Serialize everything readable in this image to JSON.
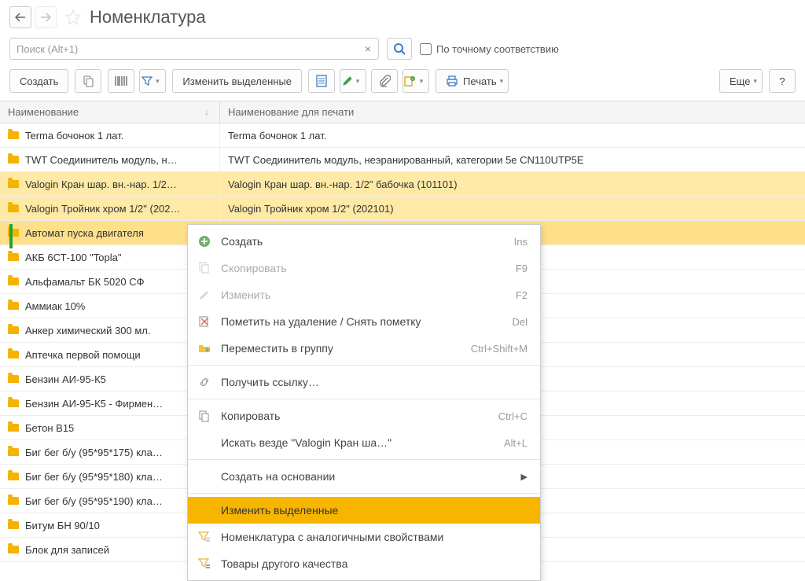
{
  "header": {
    "title": "Номенклатура"
  },
  "search": {
    "placeholder": "Поиск (Alt+1)",
    "exact_label": "По точному соответствию"
  },
  "toolbar": {
    "create": "Создать",
    "change_selected": "Изменить выделенные",
    "print": "Печать",
    "more": "Еще",
    "help": "?"
  },
  "columns": {
    "name": "Наименование",
    "print_name": "Наименование для печати"
  },
  "rows": [
    {
      "name": "Terma бочонок 1 лат.",
      "print_name": "Terma бочонок 1 лат.",
      "selected": false
    },
    {
      "name": "TWT Соедиинитель модуль, н…",
      "print_name": "TWT Соедиинитель модуль, неэранированный, категории 5e CN110UTP5E",
      "selected": false
    },
    {
      "name": "Valogin Кран шар. вн.-нар. 1/2…",
      "print_name": "Valogin Кран шар. вн.-нар. 1/2\" бабочка (101101)",
      "selected": true
    },
    {
      "name": "Valogin Тройник хром 1/2\" (202…",
      "print_name": "Valogin Тройник хром 1/2\" (202101)",
      "selected": true
    },
    {
      "name": "Автомат пуска двигателя",
      "print_name": "",
      "selected": true,
      "current": true
    },
    {
      "name": "АКБ 6СТ-100 \"Topla\"",
      "print_name": "",
      "selected": false
    },
    {
      "name": "Альфамальт БК 5020 СФ",
      "print_name": "",
      "selected": false
    },
    {
      "name": "Аммиак 10%",
      "print_name": "",
      "selected": false
    },
    {
      "name": "Анкер химический 300 мл.",
      "print_name": "",
      "selected": false
    },
    {
      "name": "Аптечка первой помощи",
      "print_name": "",
      "selected": false
    },
    {
      "name": "Бензин АИ-95-К5",
      "print_name": "",
      "selected": false
    },
    {
      "name": "Бензин АИ-95-К5 - Фирмен…",
      "print_name": "",
      "selected": false
    },
    {
      "name": "Бетон В15",
      "print_name": "",
      "selected": false
    },
    {
      "name": "Биг бег б/у (95*95*175) кла…",
      "print_name": "",
      "selected": false
    },
    {
      "name": "Биг бег б/у (95*95*180) кла…",
      "print_name": "",
      "selected": false
    },
    {
      "name": "Биг бег б/у (95*95*190) кла…",
      "print_name": "",
      "selected": false
    },
    {
      "name": "Битум БН 90/10",
      "print_name": "",
      "selected": false
    },
    {
      "name": "Блок для записей",
      "print_name": "",
      "selected": false
    }
  ],
  "context_menu": [
    {
      "label": "Создать",
      "shortcut": "Ins",
      "icon": "plus-circle"
    },
    {
      "label": "Скопировать",
      "shortcut": "F9",
      "icon": "copy-page",
      "disabled": true
    },
    {
      "label": "Изменить",
      "shortcut": "F2",
      "icon": "pencil",
      "disabled": true
    },
    {
      "label": "Пометить на удаление / Снять пометку",
      "shortcut": "Del",
      "icon": "delete-mark"
    },
    {
      "label": "Переместить в группу",
      "shortcut": "Ctrl+Shift+M",
      "icon": "move-folder"
    },
    {
      "sep": true
    },
    {
      "label": "Получить ссылку…",
      "shortcut": "",
      "icon": "link"
    },
    {
      "sep": true
    },
    {
      "label": "Копировать",
      "shortcut": "Ctrl+C",
      "icon": "copy"
    },
    {
      "label": "Искать везде \"Valogin Кран ша…\"",
      "shortcut": "Alt+L",
      "icon": ""
    },
    {
      "sep": true
    },
    {
      "label": "Создать на основании",
      "shortcut": "",
      "icon": "",
      "submenu": true
    },
    {
      "sep": true
    },
    {
      "label": "Изменить выделенные",
      "shortcut": "",
      "icon": "",
      "highlighted": true
    },
    {
      "label": "Номенклатура с аналогичными свойствами",
      "shortcut": "",
      "icon": "filter-list"
    },
    {
      "label": "Товары другого качества",
      "shortcut": "",
      "icon": "filter-stack"
    }
  ]
}
